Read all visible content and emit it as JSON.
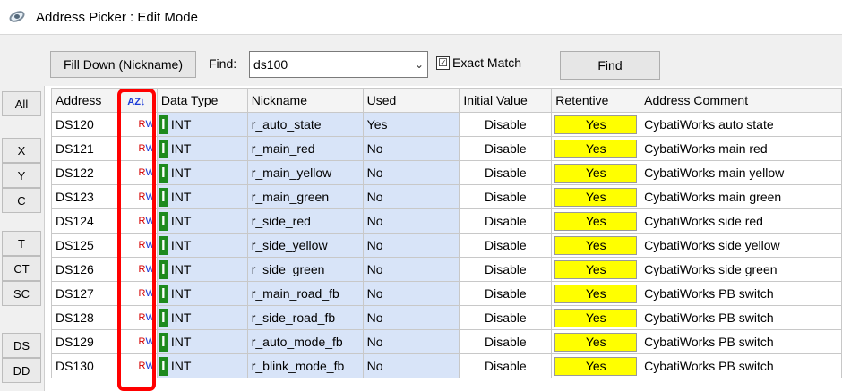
{
  "window": {
    "title": "Address Picker : Edit Mode"
  },
  "toolbar": {
    "fill_down_label": "Fill Down (Nickname)",
    "find_label": "Find:",
    "find_value": "ds100",
    "exact_match_label": "Exact Match",
    "exact_match_checked": "☑",
    "find_button_label": "Find"
  },
  "sidebar": {
    "buttons": [
      "All",
      "X",
      "Y",
      "C",
      "T",
      "CT",
      "SC",
      "DS",
      "DD"
    ]
  },
  "table": {
    "columns": [
      "Address",
      "",
      "Data Type",
      "Nickname",
      "Used",
      "Initial Value",
      "Retentive",
      "Address Comment"
    ],
    "rows": [
      {
        "address": "DS120",
        "rw_r": "R",
        "rw_w": "W",
        "dtype": "INT",
        "nickname": "r_auto_state",
        "used": "Yes",
        "initial": "Disable",
        "retentive": "Yes",
        "comment": "CybatiWorks auto state"
      },
      {
        "address": "DS121",
        "rw_r": "R",
        "rw_w": "W",
        "dtype": "INT",
        "nickname": "r_main_red",
        "used": "No",
        "initial": "Disable",
        "retentive": "Yes",
        "comment": "CybatiWorks main red"
      },
      {
        "address": "DS122",
        "rw_r": "R",
        "rw_w": "W",
        "dtype": "INT",
        "nickname": "r_main_yellow",
        "used": "No",
        "initial": "Disable",
        "retentive": "Yes",
        "comment": "CybatiWorks main yellow"
      },
      {
        "address": "DS123",
        "rw_r": "R",
        "rw_w": "W",
        "dtype": "INT",
        "nickname": "r_main_green",
        "used": "No",
        "initial": "Disable",
        "retentive": "Yes",
        "comment": "CybatiWorks main green"
      },
      {
        "address": "DS124",
        "rw_r": "R",
        "rw_w": "W",
        "dtype": "INT",
        "nickname": "r_side_red",
        "used": "No",
        "initial": "Disable",
        "retentive": "Yes",
        "comment": "CybatiWorks side red"
      },
      {
        "address": "DS125",
        "rw_r": "R",
        "rw_w": "W",
        "dtype": "INT",
        "nickname": "r_side_yellow",
        "used": "No",
        "initial": "Disable",
        "retentive": "Yes",
        "comment": "CybatiWorks side yellow"
      },
      {
        "address": "DS126",
        "rw_r": "R",
        "rw_w": "W",
        "dtype": "INT",
        "nickname": "r_side_green",
        "used": "No",
        "initial": "Disable",
        "retentive": "Yes",
        "comment": "CybatiWorks side green"
      },
      {
        "address": "DS127",
        "rw_r": "R",
        "rw_w": "W",
        "dtype": "INT",
        "nickname": "r_main_road_fb",
        "used": "No",
        "initial": "Disable",
        "retentive": "Yes",
        "comment": "CybatiWorks PB switch"
      },
      {
        "address": "DS128",
        "rw_r": "R",
        "rw_w": "W",
        "dtype": "INT",
        "nickname": "r_side_road_fb",
        "used": "No",
        "initial": "Disable",
        "retentive": "Yes",
        "comment": "CybatiWorks PB switch"
      },
      {
        "address": "DS129",
        "rw_r": "R",
        "rw_w": "W",
        "dtype": "INT",
        "nickname": "r_auto_mode_fb",
        "used": "No",
        "initial": "Disable",
        "retentive": "Yes",
        "comment": "CybatiWorks PB switch"
      },
      {
        "address": "DS130",
        "rw_r": "R",
        "rw_w": "W",
        "dtype": "INT",
        "nickname": "r_blink_mode_fb",
        "used": "No",
        "initial": "Disable",
        "retentive": "Yes",
        "comment": "CybatiWorks PB switch"
      }
    ]
  },
  "colors": {
    "highlight": "#ff0000",
    "retentive_yes": "#ffff00",
    "editable_cell": "#d8e4f8",
    "int_icon": "#1e8a1e"
  }
}
